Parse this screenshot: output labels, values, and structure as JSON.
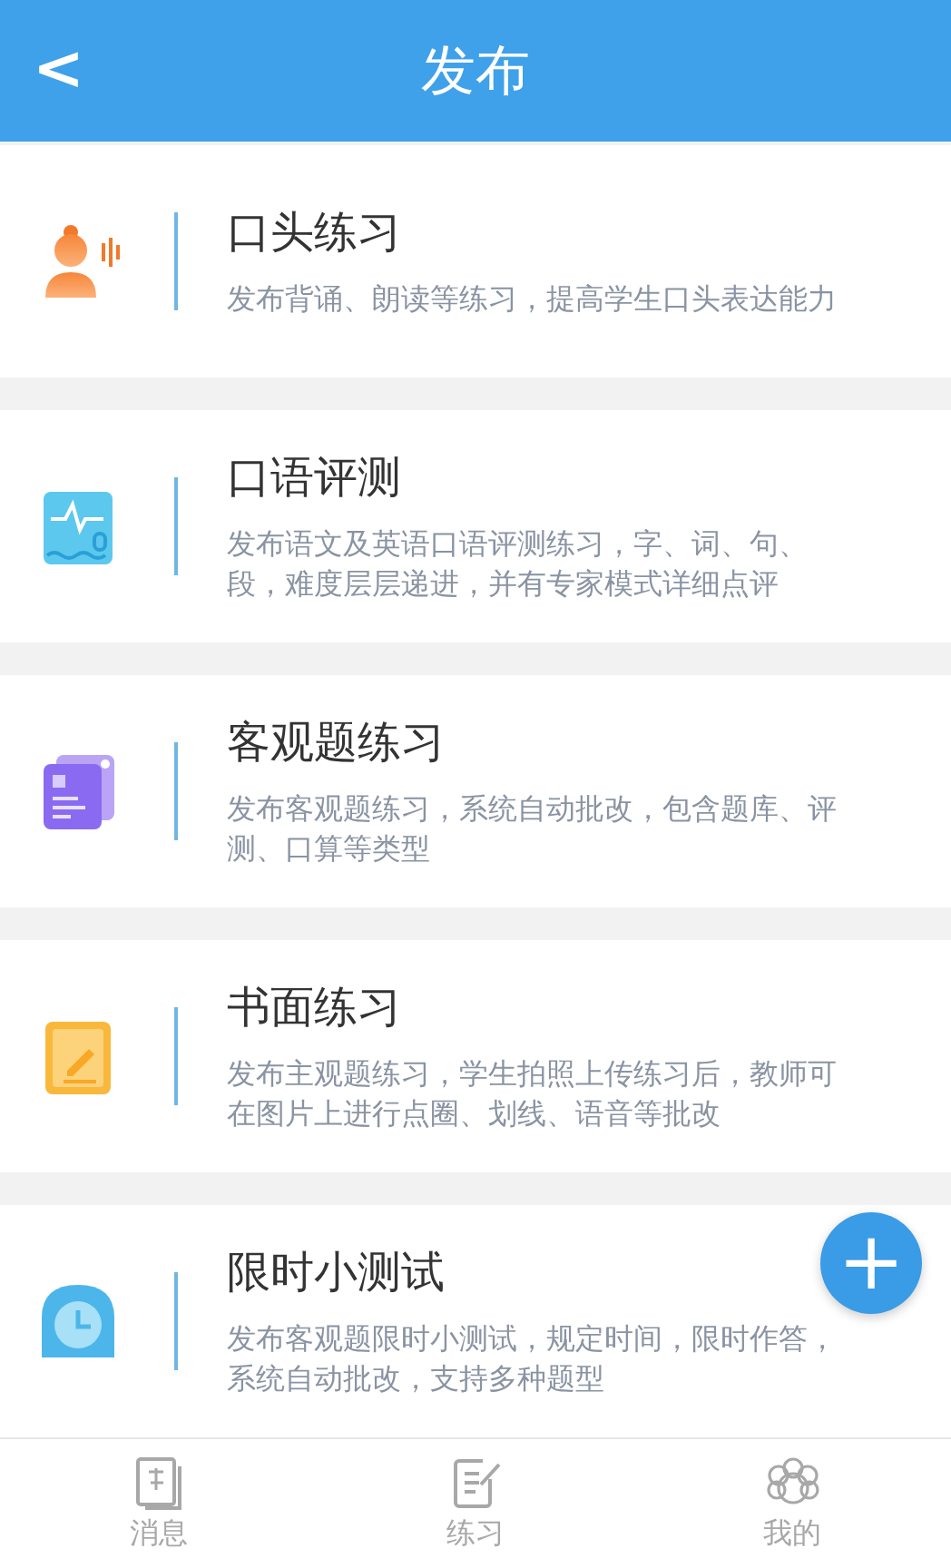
{
  "header": {
    "back": "<",
    "title": "发布"
  },
  "items": [
    {
      "kind": "oral",
      "title": "口头练习",
      "description": "发布背诵、朗读等练习，提高学生口头表达能力"
    },
    {
      "kind": "speech",
      "title": "口语评测",
      "description": "发布语文及英语口语评测练习，字、词、句、段，难度层层递进，并有专家模式详细点评"
    },
    {
      "kind": "objective",
      "title": "客观题练习",
      "description": "发布客观题练习，系统自动批改，包含题库、评测、口算等类型"
    },
    {
      "kind": "written",
      "title": "书面练习",
      "description": "发布主观题练习，学生拍照上传练习后，教师可在图片上进行点圈、划线、语音等批改"
    },
    {
      "kind": "timed",
      "title": "限时小测试",
      "description": "发布客观题限时小测试，规定时间，限时作答，系统自动批改，支持多种题型"
    }
  ],
  "fab": "+",
  "tabs": [
    {
      "kind": "messages",
      "label": "消息",
      "selected": false
    },
    {
      "kind": "practice",
      "label": "练习",
      "selected": false
    },
    {
      "kind": "profile",
      "label": "我的",
      "selected": false
    }
  ]
}
